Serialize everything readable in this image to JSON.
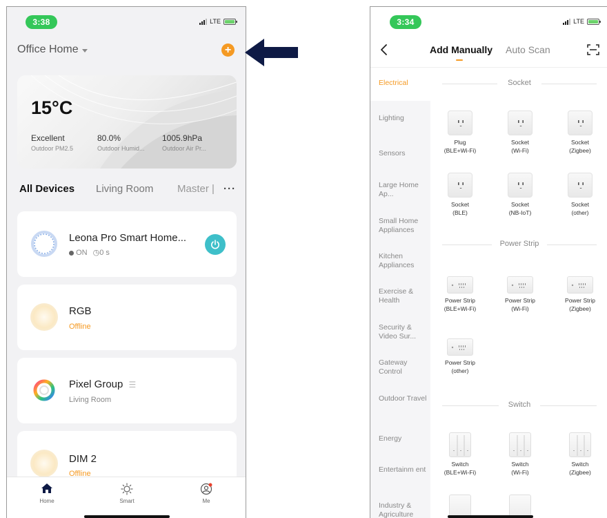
{
  "left": {
    "status": {
      "time": "3:38",
      "network": "LTE"
    },
    "home_title": "Office Home",
    "add_button": "+",
    "weather": {
      "temperature": "15°C",
      "stats": [
        {
          "value": "Excellent",
          "label": "Outdoor PM2.5"
        },
        {
          "value": "80.0%",
          "label": "Outdoor Humid..."
        },
        {
          "value": "1005.9hPa",
          "label": "Outdoor Air Pr..."
        }
      ]
    },
    "tabs": {
      "all": "All Devices",
      "living": "Living Room",
      "master": "Master |",
      "more": "···"
    },
    "devices": [
      {
        "name": "Leona Pro Smart Home...",
        "state": "ON",
        "timer": "0 s"
      },
      {
        "name": "RGB",
        "status": "Offline"
      },
      {
        "name": "Pixel Group",
        "room": "Living Room"
      },
      {
        "name": "DIM 2",
        "status": "Offline"
      }
    ],
    "tabbar": {
      "home": "Home",
      "smart": "Smart",
      "me": "Me"
    }
  },
  "right": {
    "status": {
      "time": "3:34",
      "network": "LTE"
    },
    "header": {
      "manual": "Add Manually",
      "auto": "Auto Scan"
    },
    "categories": [
      "Electrical",
      "Lighting",
      "Sensors",
      "Large Home Ap...",
      "Small Home Appliances",
      "Kitchen Appliances",
      "Exercise & Health",
      "Security & Video Sur...",
      "Gateway Control",
      "Outdoor Travel",
      "Energy",
      "Entertainm ent",
      "Industry & Agriculture"
    ],
    "sections": {
      "socket": "Socket",
      "power_strip": "Power Strip",
      "switch": "Switch"
    },
    "sockets": [
      {
        "l1": "Plug",
        "l2": "(BLE+Wi-Fi)"
      },
      {
        "l1": "Socket",
        "l2": "(Wi-Fi)"
      },
      {
        "l1": "Socket",
        "l2": "(Zigbee)"
      },
      {
        "l1": "Socket",
        "l2": "(BLE)"
      },
      {
        "l1": "Socket",
        "l2": "(NB-IoT)"
      },
      {
        "l1": "Socket",
        "l2": "(other)"
      }
    ],
    "strips": [
      {
        "l1": "Power Strip",
        "l2": "(BLE+Wi-Fi)"
      },
      {
        "l1": "Power Strip",
        "l2": "(Wi-Fi)"
      },
      {
        "l1": "Power Strip",
        "l2": "(Zigbee)"
      },
      {
        "l1": "Power Strip",
        "l2": "(other)"
      }
    ],
    "switches": [
      {
        "l1": "Switch",
        "l2": "(BLE+Wi-Fi)"
      },
      {
        "l1": "Switch",
        "l2": "(Wi-Fi)"
      },
      {
        "l1": "Switch",
        "l2": "(Zigbee)"
      }
    ]
  },
  "colors": {
    "accent": "#f59a23",
    "power": "#3ebfc9",
    "arrow": "#0e1a45",
    "status_green": "#34c759"
  }
}
